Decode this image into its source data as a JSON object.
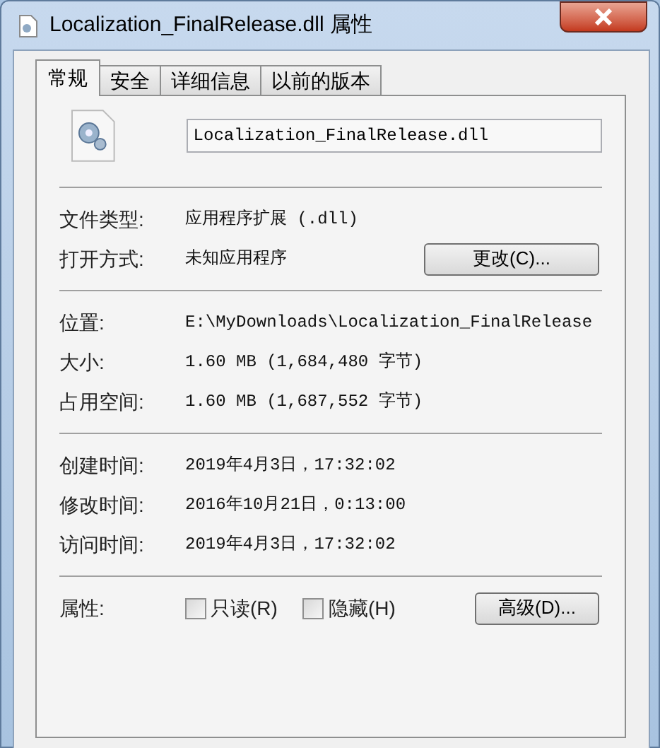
{
  "window": {
    "title": "Localization_FinalRelease.dll 属性"
  },
  "tabs": [
    {
      "label": "常规",
      "selected": true
    },
    {
      "label": "安全",
      "selected": false
    },
    {
      "label": "详细信息",
      "selected": false
    },
    {
      "label": "以前的版本",
      "selected": false
    }
  ],
  "file_name": {
    "value": "Localization_FinalRelease.dll"
  },
  "sections": [
    [
      {
        "label": "文件类型:",
        "value": "应用程序扩展 (.dll)"
      },
      {
        "label": "打开方式:",
        "value": "未知应用程序",
        "button": "更改(C)..."
      }
    ],
    [
      {
        "label": "位置:",
        "value": "E:\\MyDownloads\\Localization_FinalRelease"
      },
      {
        "label": "大小:",
        "value": "1.60 MB (1,684,480 字节)"
      },
      {
        "label": "占用空间:",
        "value": "1.60 MB (1,687,552 字节)"
      }
    ],
    [
      {
        "label": "创建时间:",
        "value": "2019年4月3日，17:32:02"
      },
      {
        "label": "修改时间:",
        "value": "2016年10月21日，0:13:00"
      },
      {
        "label": "访问时间:",
        "value": "2019年4月3日，17:32:02"
      }
    ]
  ],
  "attributes": {
    "label": "属性:",
    "checkboxes": [
      {
        "label": "只读(R)",
        "checked": false
      },
      {
        "label": "隐藏(H)",
        "checked": false
      }
    ],
    "button": "高级(D)..."
  }
}
